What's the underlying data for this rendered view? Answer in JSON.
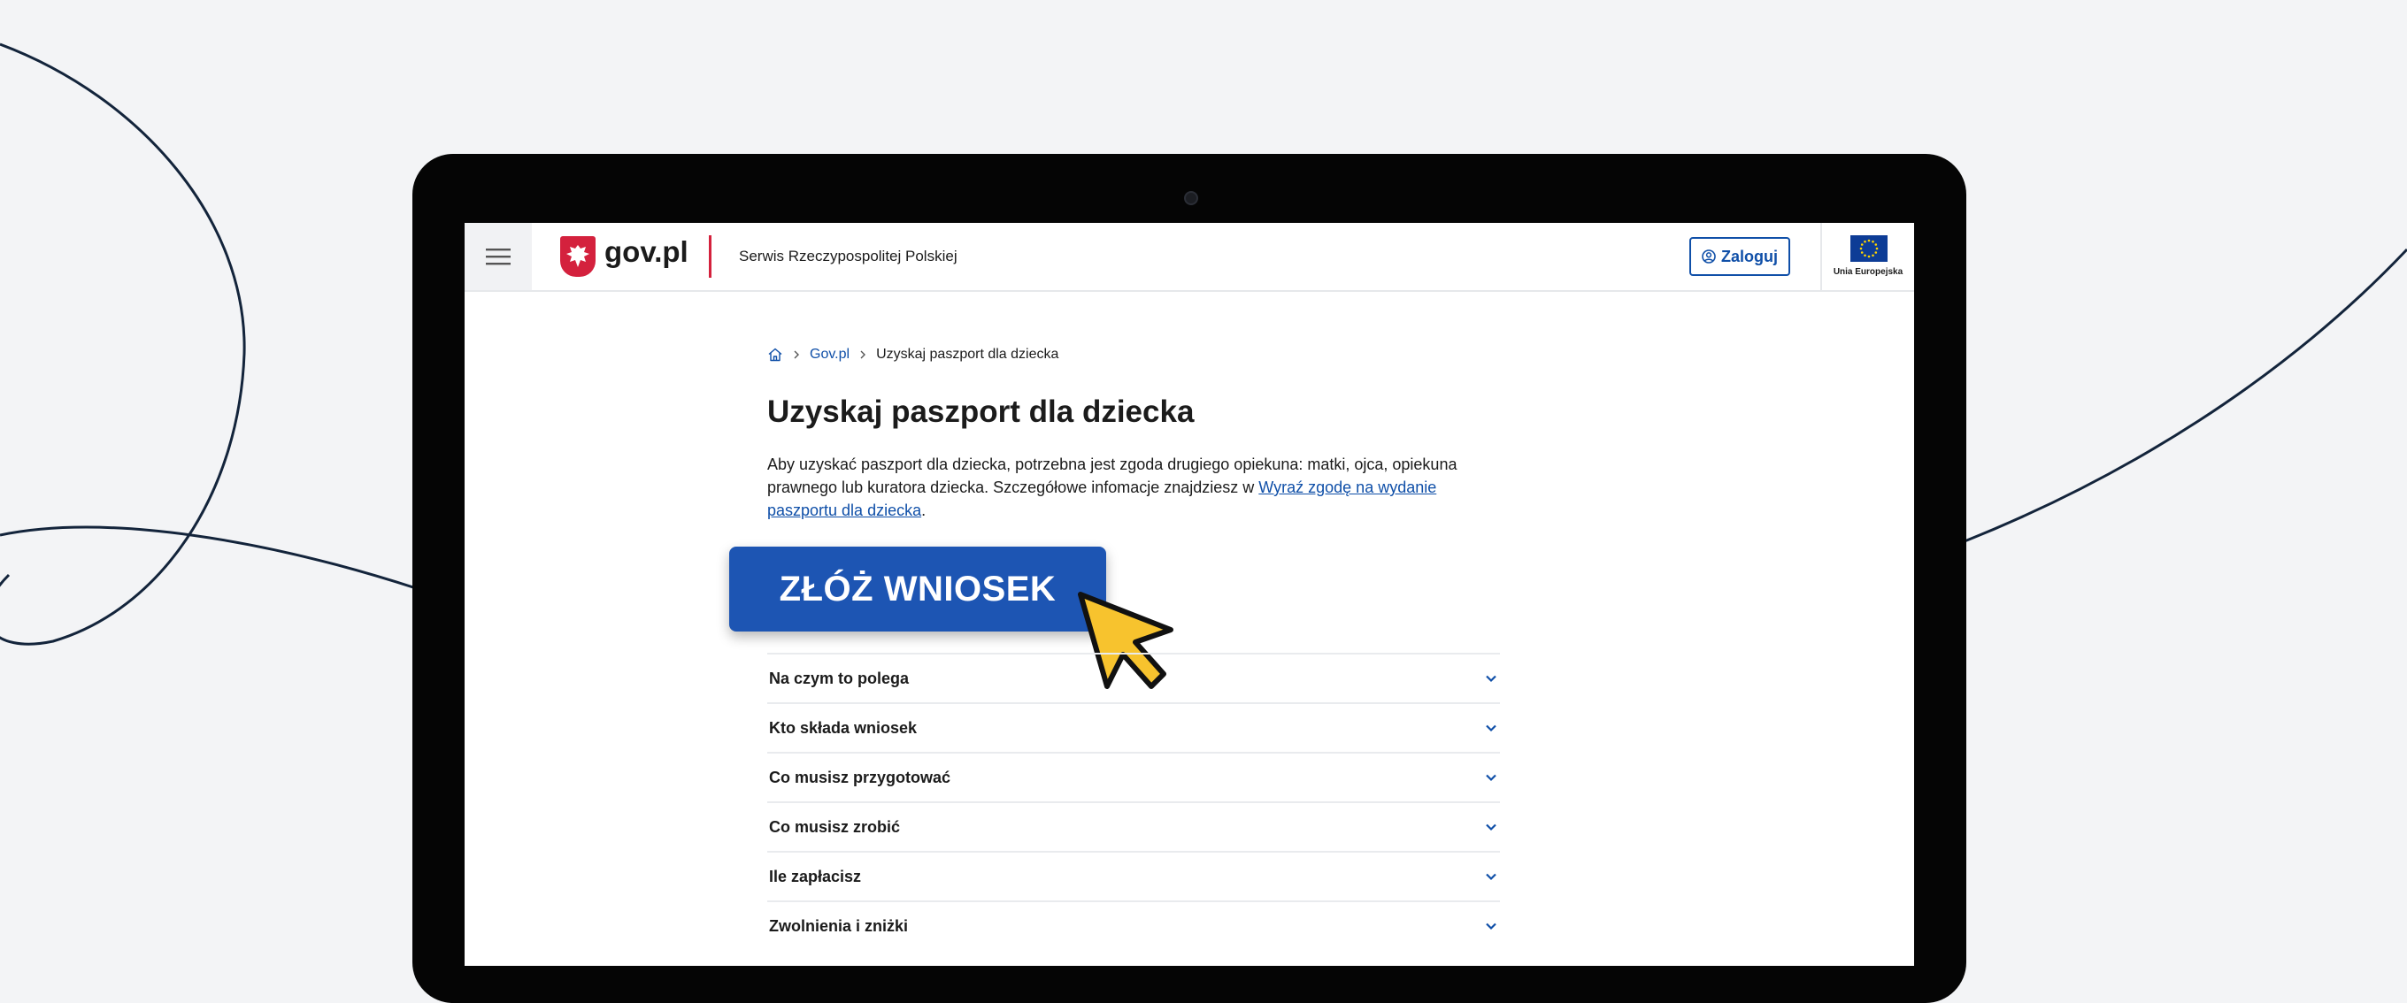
{
  "header": {
    "logo_text": "gov.pl",
    "service_name": "Serwis Rzeczypospolitej Polskiej",
    "login_label": "Zaloguj",
    "eu_label": "Unia Europejska"
  },
  "breadcrumb": {
    "items": [
      "Gov.pl",
      "Uzyskaj paszport dla dziecka"
    ]
  },
  "page": {
    "title": "Uzyskaj paszport dla dziecka",
    "intro_text": "Aby uzyskać paszport dla dziecka, potrzebna jest zgoda drugiego opiekuna: matki, ojca, opiekuna prawnego lub kuratora dziecka. Szczegółowe infomacje znajdziesz w ",
    "intro_link": "Wyraź zgodę na wydanie paszportu dla dziecka",
    "intro_end": ".",
    "apply_button": "ZŁÓŻ WNIOSEK"
  },
  "accordion": {
    "items": [
      "Na czym to polega",
      "Kto składa wniosek",
      "Co musisz przygotować",
      "Co musisz zrobić",
      "Ile zapłacisz",
      "Zwolnienia i zniżki"
    ]
  },
  "colors": {
    "background": "#f3f4f6",
    "primary_blue": "#1d55b3",
    "link_blue": "#0f4fa8",
    "red": "#d4213d",
    "cursor_yellow": "#f7c32e"
  }
}
